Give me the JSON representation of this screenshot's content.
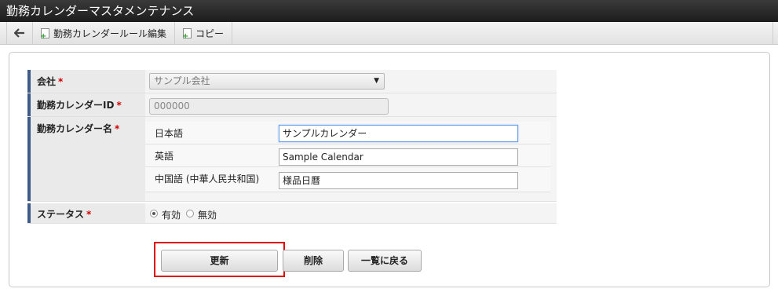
{
  "window": {
    "title": "勤務カレンダーマスタメンテナンス"
  },
  "toolbar": {
    "back_icon": "arrow-left-icon",
    "rule_edit_label": "勤務カレンダールール編集",
    "copy_label": "コピー"
  },
  "form": {
    "company": {
      "label": "会社",
      "required": "*",
      "value": "サンプル会社"
    },
    "calendar_id": {
      "label": "勤務カレンダーID",
      "required": "*",
      "value": "000000"
    },
    "calendar_name": {
      "label": "勤務カレンダー名",
      "required": "*",
      "langs": [
        {
          "label": "日本語",
          "value": "サンプルカレンダー"
        },
        {
          "label": "英語",
          "value": "Sample Calendar"
        },
        {
          "label": "中国語 (中華人民共和国)",
          "value": "様品日曆"
        }
      ]
    },
    "status": {
      "label": "ステータス",
      "required": "*",
      "options": [
        {
          "label": "有効",
          "selected": true
        },
        {
          "label": "無効",
          "selected": false
        }
      ]
    }
  },
  "actions": {
    "update_label": "更新",
    "delete_label": "削除",
    "back_to_list_label": "一覧に戻る"
  },
  "colors": {
    "highlight": "#e00000",
    "label_bar": "#3e5b8a",
    "required": "#d00000"
  }
}
